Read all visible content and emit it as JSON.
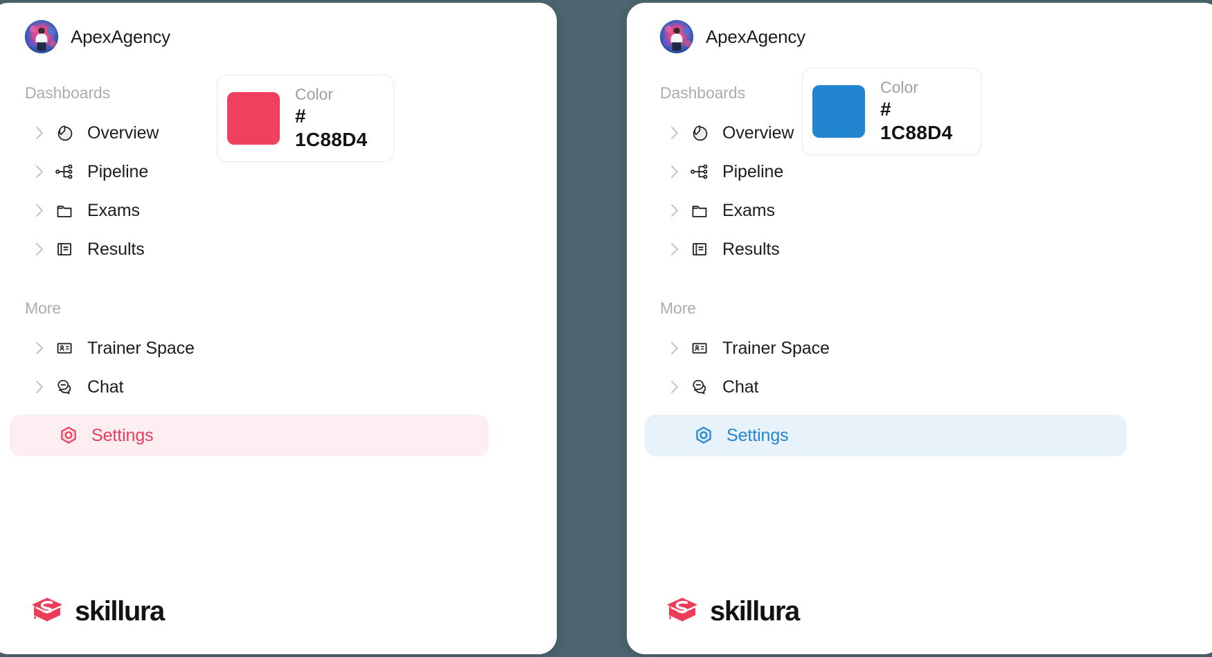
{
  "background_color": "#4D666F",
  "panels": [
    {
      "id": "left",
      "theme_color": "#EF4060",
      "brand": {
        "name": "ApexAgency",
        "avatar": "user-avatar-photo"
      },
      "sections": [
        {
          "label": "Dashboards",
          "items": [
            {
              "label": "Overview",
              "icon": "pie-chart-icon",
              "expandable": true
            },
            {
              "label": "Pipeline",
              "icon": "network-nodes-icon",
              "expandable": true
            },
            {
              "label": "Exams",
              "icon": "folder-icon",
              "expandable": true
            },
            {
              "label": "Results",
              "icon": "book-list-icon",
              "expandable": true
            }
          ]
        },
        {
          "label": "More",
          "items": [
            {
              "label": "Trainer Space",
              "icon": "id-card-icon",
              "expandable": true
            },
            {
              "label": "Chat",
              "icon": "chat-bubble-minus-icon",
              "expandable": true
            },
            {
              "label": "Settings",
              "icon": "hexagon-dot-icon",
              "expandable": false,
              "active": true
            }
          ]
        }
      ],
      "color_card": {
        "label": "Color",
        "value": "# 1C88D4",
        "swatch_color": "#EF4060"
      },
      "footer": {
        "logo_text": "skillura",
        "logo_mark": "graduation-cap-s-icon",
        "logo_color": "#EE3B58"
      }
    },
    {
      "id": "right",
      "theme_color": "#1C88D4",
      "brand": {
        "name": "ApexAgency",
        "avatar": "user-avatar-photo"
      },
      "sections": [
        {
          "label": "Dashboards",
          "items": [
            {
              "label": "Overview",
              "icon": "pie-chart-icon",
              "expandable": true
            },
            {
              "label": "Pipeline",
              "icon": "network-nodes-icon",
              "expandable": true
            },
            {
              "label": "Exams",
              "icon": "folder-icon",
              "expandable": true
            },
            {
              "label": "Results",
              "icon": "book-list-icon",
              "expandable": true
            }
          ]
        },
        {
          "label": "More",
          "items": [
            {
              "label": "Trainer Space",
              "icon": "id-card-icon",
              "expandable": true
            },
            {
              "label": "Chat",
              "icon": "chat-bubble-minus-icon",
              "expandable": true
            },
            {
              "label": "Settings",
              "icon": "hexagon-dot-icon",
              "expandable": false,
              "active": true
            }
          ]
        }
      ],
      "color_card": {
        "label": "Color",
        "value": "# 1C88D4",
        "swatch_color": "#2185D0"
      },
      "footer": {
        "logo_text": "skillura",
        "logo_mark": "graduation-cap-s-icon",
        "logo_color": "#EE3B58"
      }
    }
  ]
}
